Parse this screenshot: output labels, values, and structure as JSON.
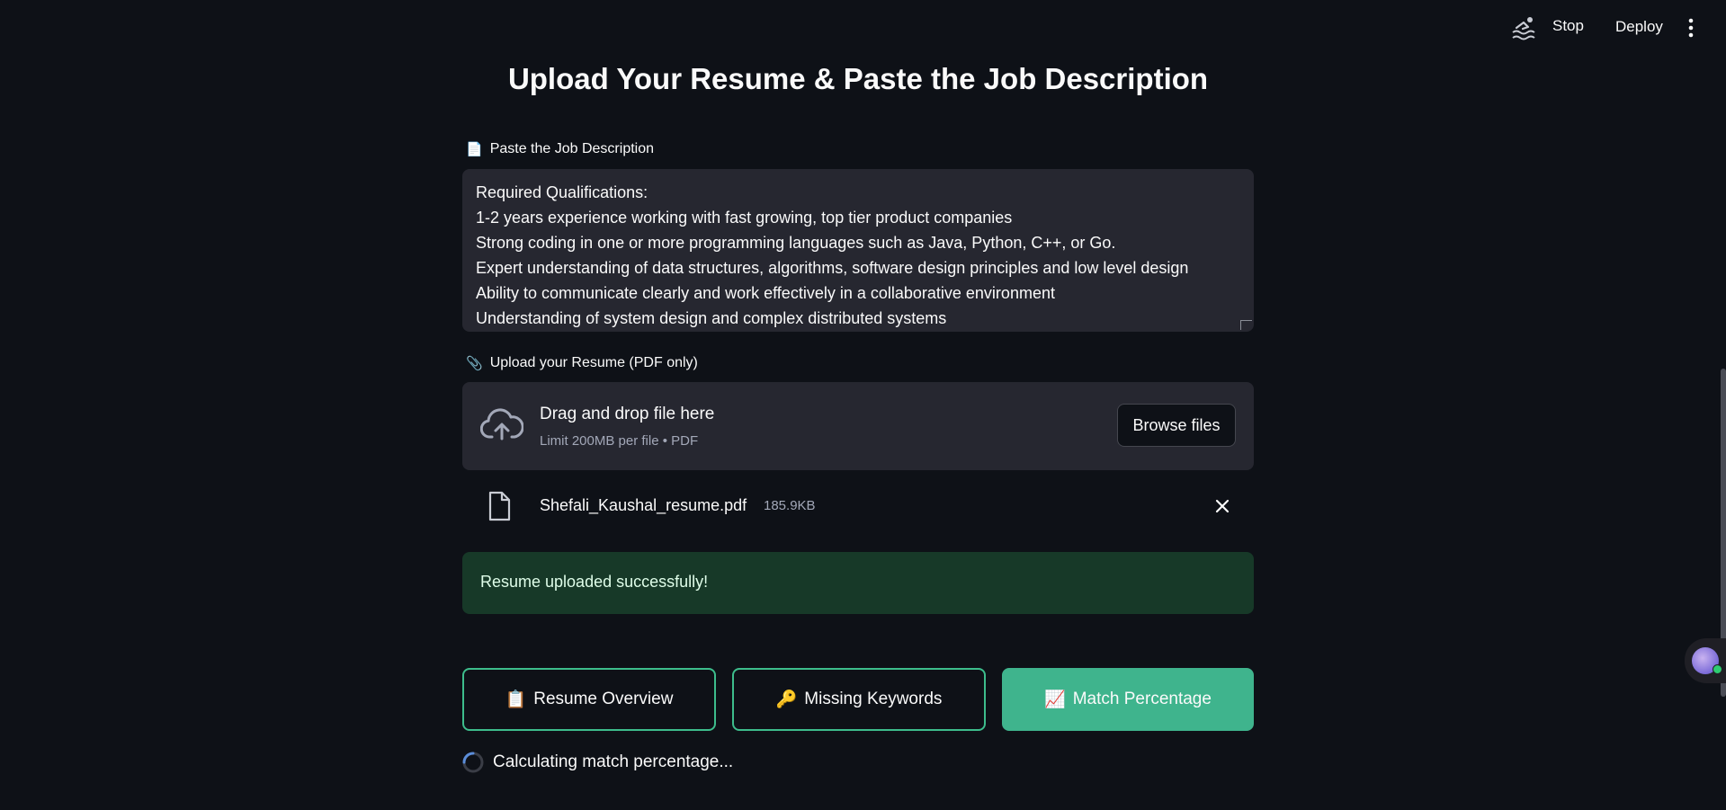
{
  "header": {
    "stop_label": "Stop",
    "deploy_label": "Deploy"
  },
  "page": {
    "title": "Upload Your Resume & Paste the Job Description"
  },
  "job_description": {
    "label_icon": "📄",
    "label": "Paste the Job Description",
    "lines": [
      "Required Qualifications:",
      "1-2 years experience working with fast growing, top tier product companies",
      "Strong coding in one or more programming languages such as Java, Python, C++, or Go.",
      "Expert understanding of data structures, algorithms, software design principles and low level design",
      "Ability to communicate clearly and work effectively in a collaborative environment",
      "Understanding of system design and complex distributed systems"
    ]
  },
  "upload": {
    "label_icon": "📎",
    "label": "Upload your Resume (PDF only)",
    "dropzone_title": "Drag and drop file here",
    "dropzone_subtitle": "Limit 200MB per file • PDF",
    "browse_label": "Browse files",
    "file_name": "Shefali_Kaushal_resume.pdf",
    "file_size": "185.9KB"
  },
  "status": {
    "success_message": "Resume uploaded successfully!",
    "spinner_text": "Calculating match percentage..."
  },
  "actions": [
    {
      "icon": "📋",
      "label": "Resume Overview"
    },
    {
      "icon": "🔑",
      "label": "Missing Keywords"
    },
    {
      "icon": "📈",
      "label": "Match Percentage"
    }
  ],
  "colors": {
    "background": "#0e1117",
    "accent": "#3fb48d",
    "success_bg": "#173928"
  }
}
